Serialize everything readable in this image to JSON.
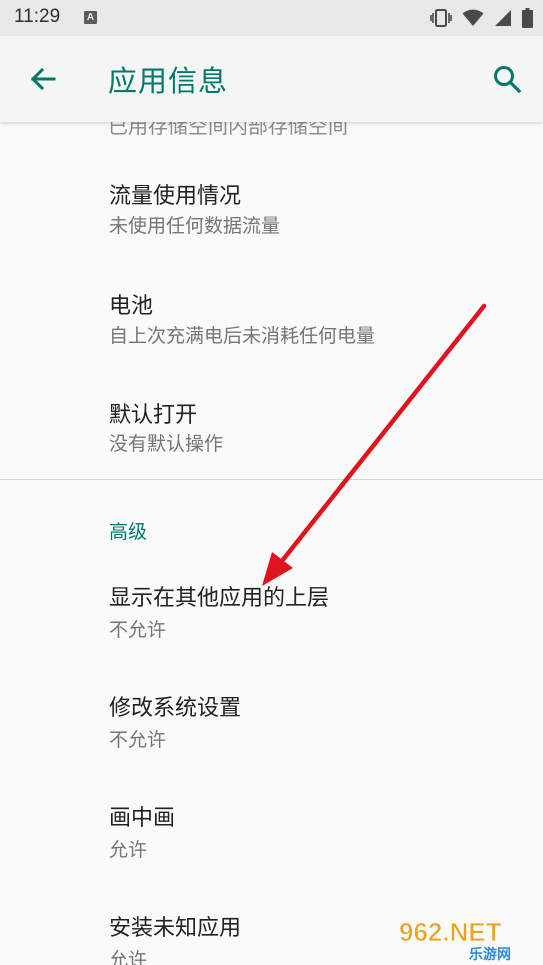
{
  "status_bar": {
    "time": "11:29",
    "notification_icon": "a-text-icon",
    "icons": [
      "vibrate-icon",
      "wifi-icon",
      "signal-icon",
      "battery-icon"
    ]
  },
  "app_bar": {
    "back_icon": "arrow-back-icon",
    "title": "应用信息",
    "search_icon": "search-icon"
  },
  "list": {
    "cut_off_text": "已用存储空间内部存储空间",
    "items": [
      {
        "title": "流量使用情况",
        "subtitle": "未使用任何数据流量"
      },
      {
        "title": "电池",
        "subtitle": "自上次充满电后未消耗任何电量"
      },
      {
        "title": "默认打开",
        "subtitle": "没有默认操作"
      }
    ],
    "advanced": {
      "header": "高级",
      "items": [
        {
          "title": "显示在其他应用的上层",
          "subtitle": "不允许"
        },
        {
          "title": "修改系统设置",
          "subtitle": "不允许"
        },
        {
          "title": "画中画",
          "subtitle": "允许"
        },
        {
          "title": "安装未知应用",
          "subtitle": "允许"
        }
      ]
    }
  },
  "annotation": {
    "type": "red-arrow",
    "color": "#e0141e"
  },
  "watermark": {
    "main": "962.NET",
    "sub": "乐游网"
  },
  "colors": {
    "accent": "#00796b",
    "background": "#fafafa"
  }
}
